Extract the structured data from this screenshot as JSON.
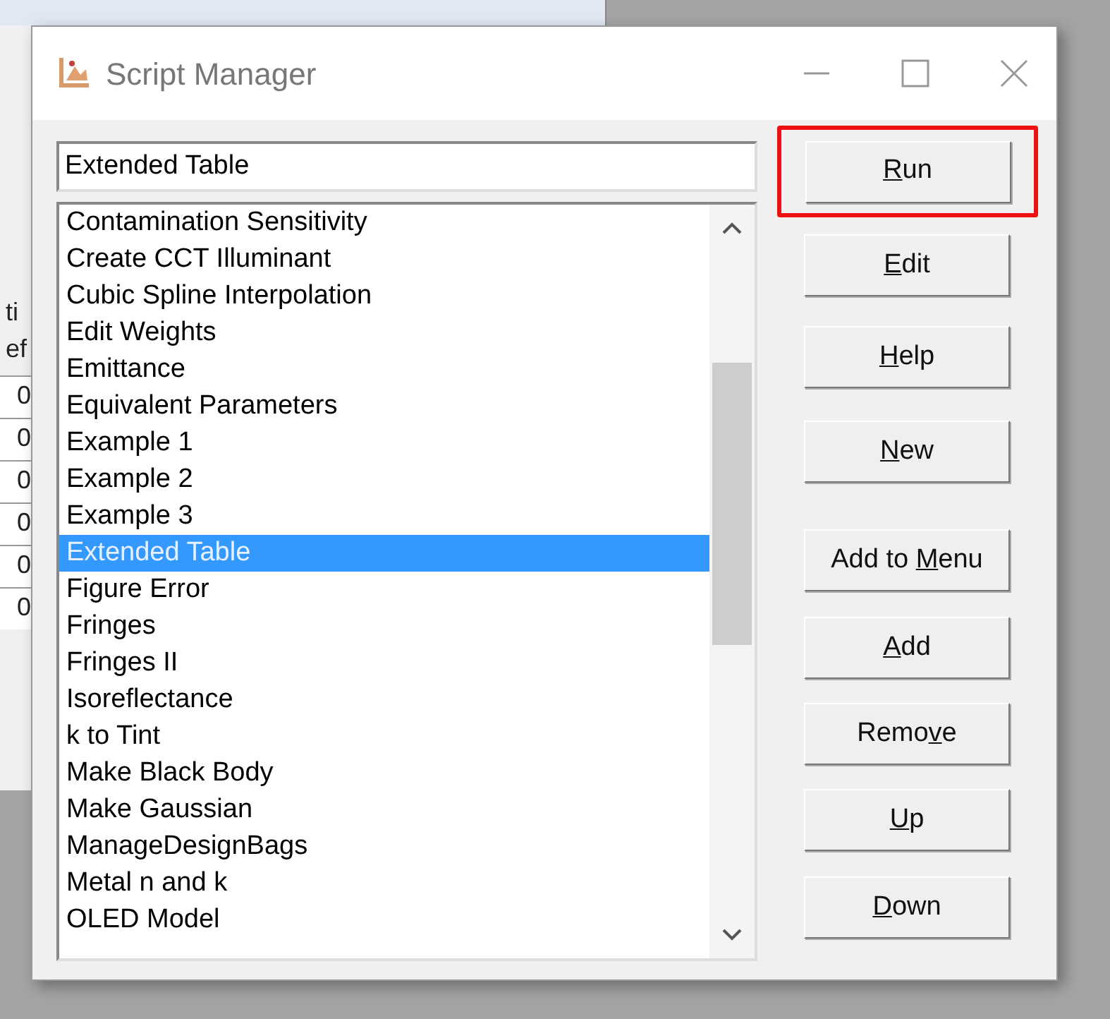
{
  "background_window": {
    "fragments": [
      "ti",
      "ef"
    ],
    "cells": [
      "0",
      "0",
      "0",
      "0",
      "0",
      "0"
    ]
  },
  "window": {
    "title": "Script Manager"
  },
  "name_field": {
    "value": "Extended Table"
  },
  "scripts": [
    {
      "label": "Contamination Sensitivity",
      "selected": false
    },
    {
      "label": "Create CCT Illuminant",
      "selected": false
    },
    {
      "label": "Cubic Spline Interpolation",
      "selected": false
    },
    {
      "label": "Edit Weights",
      "selected": false
    },
    {
      "label": "Emittance",
      "selected": false
    },
    {
      "label": "Equivalent Parameters",
      "selected": false
    },
    {
      "label": "Example 1",
      "selected": false
    },
    {
      "label": "Example 2",
      "selected": false
    },
    {
      "label": "Example 3",
      "selected": false
    },
    {
      "label": "Extended Table",
      "selected": true
    },
    {
      "label": "Figure Error",
      "selected": false
    },
    {
      "label": "Fringes",
      "selected": false
    },
    {
      "label": "Fringes II",
      "selected": false
    },
    {
      "label": "Isoreflectance",
      "selected": false
    },
    {
      "label": "k to Tint",
      "selected": false
    },
    {
      "label": "Make Black Body",
      "selected": false
    },
    {
      "label": "Make Gaussian",
      "selected": false
    },
    {
      "label": "ManageDesignBags",
      "selected": false
    },
    {
      "label": "Metal n and k",
      "selected": false
    },
    {
      "label": "OLED Model",
      "selected": false
    }
  ],
  "buttons": [
    {
      "key": "R",
      "post": "un",
      "highlighted": true
    },
    {
      "key": "E",
      "post": "dit",
      "highlighted": false
    },
    {
      "key": "H",
      "post": "elp",
      "highlighted": false
    },
    {
      "key": "N",
      "post": "ew",
      "highlighted": false
    },
    {
      "pre": "Add to ",
      "key": "M",
      "post": "enu",
      "highlighted": false
    },
    {
      "key": "A",
      "post": "dd",
      "highlighted": false
    },
    {
      "pre": "Remo",
      "key": "v",
      "post": "e",
      "highlighted": false
    },
    {
      "key": "U",
      "post": "p",
      "highlighted": false
    },
    {
      "key": "D",
      "post": "own",
      "highlighted": false
    }
  ]
}
